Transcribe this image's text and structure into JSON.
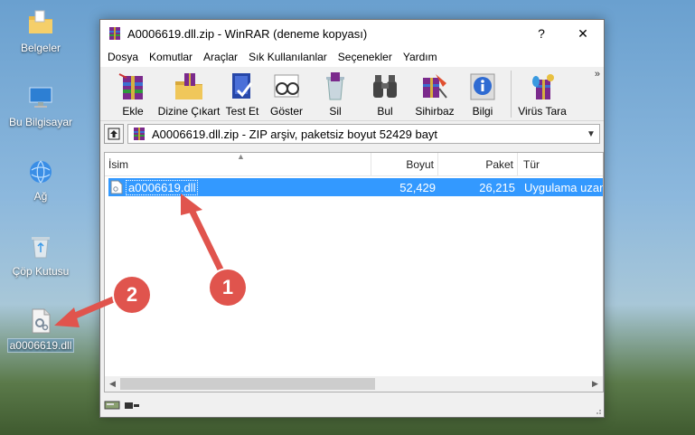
{
  "desktop": {
    "icons": [
      {
        "label": "Belgeler"
      },
      {
        "label": "Bu Bilgisayar"
      },
      {
        "label": "Ağ"
      },
      {
        "label": "Çöp Kutusu"
      },
      {
        "label": "a0006619.dll"
      }
    ]
  },
  "window": {
    "title": "A0006619.dll.zip - WinRAR (deneme kopyası)",
    "help_label": "?",
    "close_label": "✕"
  },
  "menu": [
    "Dosya",
    "Komutlar",
    "Araçlar",
    "Sık Kullanılanlar",
    "Seçenekler",
    "Yardım"
  ],
  "toolbar": {
    "buttons": [
      "Ekle",
      "Dizine Çıkart",
      "Test Et",
      "Göster",
      "Sil",
      "Bul",
      "Sihirbaz",
      "Bilgi",
      "Virüs Tara"
    ],
    "more": "»"
  },
  "address": {
    "text": "A0006619.dll.zip - ZIP arşiv, paketsiz boyut 52429 bayt"
  },
  "columns": {
    "name": "İsim",
    "size": "Boyut",
    "packed": "Paket",
    "type": "Tür"
  },
  "files": [
    {
      "name": "a0006619.dll",
      "size": "52,429",
      "packed": "26,215",
      "type": "Uygulama uzantısı"
    }
  ],
  "annotations": {
    "badge1": "1",
    "badge2": "2"
  },
  "colors": {
    "selection": "#3399ff",
    "badge": "#e0544d"
  }
}
